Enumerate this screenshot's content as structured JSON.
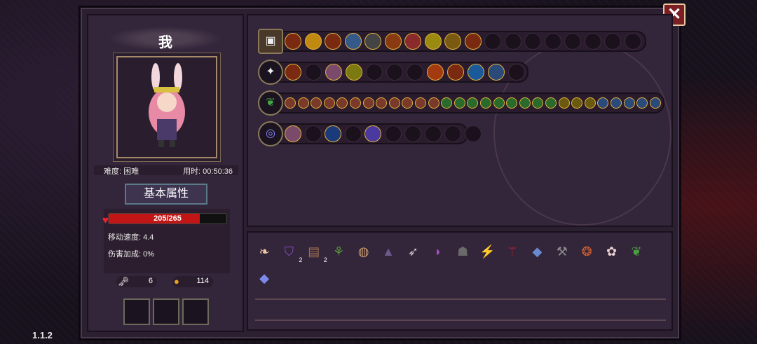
{
  "version": "1.1.2",
  "player": {
    "name": "我"
  },
  "info": {
    "difficulty": "难度: 困难",
    "time": "用时: 00:50:36"
  },
  "tab_label": "基本属性",
  "hp": {
    "current": 205,
    "max": 265,
    "text": "205/265"
  },
  "stats": {
    "move_speed": "移动速度: 4.4",
    "damage_bonus": "伤害加成: 0%"
  },
  "counters": {
    "keys": "6",
    "coins": "114"
  },
  "close_label": "✕",
  "icons": [
    "close-icon",
    "heart-icon",
    "key-icon",
    "coin-icon",
    "chest-icon",
    "staff-icon",
    "herb-icon",
    "vortex-icon"
  ],
  "item_counts": {
    "hat": "2",
    "bag": "2"
  },
  "colors": {
    "hp": "#c21515",
    "frame": "#2b2030",
    "close": "#7a1f24"
  }
}
